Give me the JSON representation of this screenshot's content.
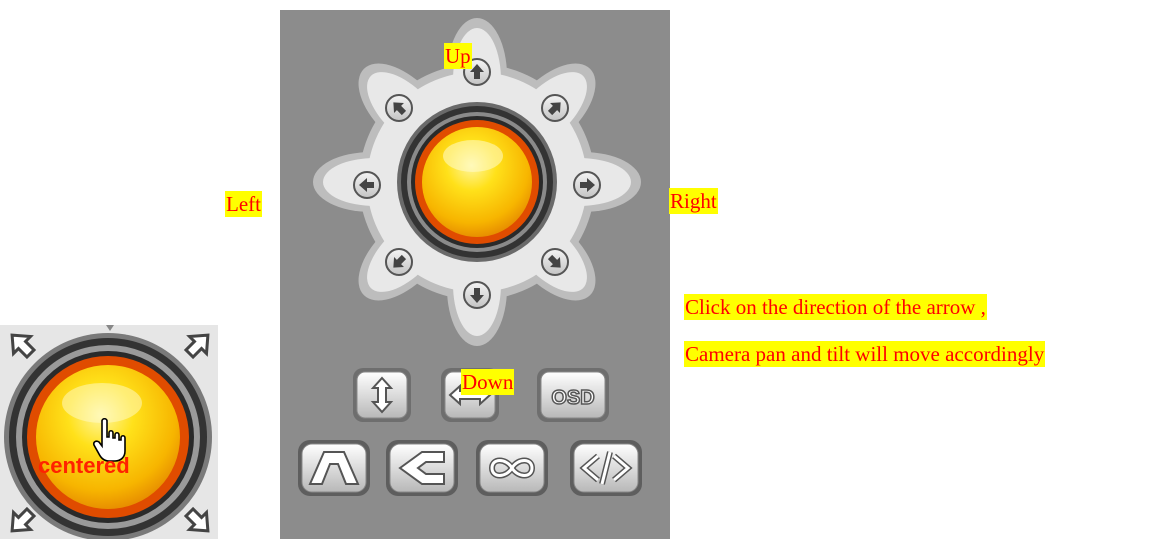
{
  "ptz": {
    "labels": {
      "up": "Up",
      "down": "Down",
      "left": "Left",
      "right": "Right"
    },
    "osd_label": "OSD",
    "buttons": [
      {
        "name": "vertical-patrol-button",
        "icon": "updown-arrow-icon"
      },
      {
        "name": "horizontal-patrol-button",
        "icon": "leftright-arrow-icon"
      },
      {
        "name": "osd-button",
        "icon": "osd-icon"
      },
      {
        "name": "flip-button",
        "icon": "flip-icon"
      },
      {
        "name": "mirror-button",
        "icon": "mirror-icon"
      },
      {
        "name": "center-loop-button",
        "icon": "infinity-icon"
      },
      {
        "name": "code-button",
        "icon": "code-icon"
      }
    ],
    "colors": {
      "panel": "#8c8c8c",
      "center": "#ffcc00",
      "ring": "#e85a00",
      "highlight": "#ffff00",
      "text": "#ff0000"
    }
  },
  "instructions": {
    "line1": "Click on the direction of the arrow ,",
    "line2": "Camera pan and tilt will move accordingly"
  },
  "inset": {
    "label": "centered"
  }
}
